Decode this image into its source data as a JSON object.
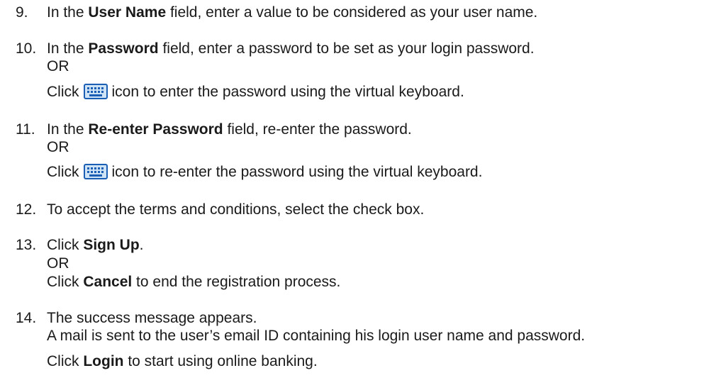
{
  "steps": [
    {
      "number": "9.",
      "before": "In the ",
      "bold": "User Name",
      "after": " field, enter a value to be considered as your user name."
    },
    {
      "number": "10.",
      "before": "In the ",
      "bold": "Password",
      "after": " field, enter a password to be set as your login password.",
      "or": "OR",
      "alt_before": "Click",
      "alt_icon": "virtual-keyboard-icon",
      "alt_after": "icon to enter the password using the virtual keyboard."
    },
    {
      "number": "11.",
      "before": "In the ",
      "bold": "Re-enter Password",
      "after": " field, re-enter the password.",
      "or": "OR",
      "alt_before": "Click",
      "alt_icon": "virtual-keyboard-icon",
      "alt_after": "icon to re-enter the password using the virtual keyboard."
    },
    {
      "number": "12.",
      "text": "To accept the terms and conditions, select the check box."
    },
    {
      "number": "13.",
      "before": "Click ",
      "bold": "Sign Up",
      "after": ".",
      "or": "OR",
      "alt_before": "Click ",
      "alt_bold": "Cancel",
      "alt_after": " to end the registration process."
    },
    {
      "number": "14.",
      "text": "The success message appears.",
      "text2": "A mail is sent to the user’s email ID containing his login user name and password.",
      "final_before": "Click ",
      "final_bold": "Login",
      "final_after": " to start using online banking."
    }
  ],
  "colors": {
    "text": "#1a1a1a",
    "icon_blue": "#1a5fb4",
    "icon_light": "#cfe3f7"
  }
}
